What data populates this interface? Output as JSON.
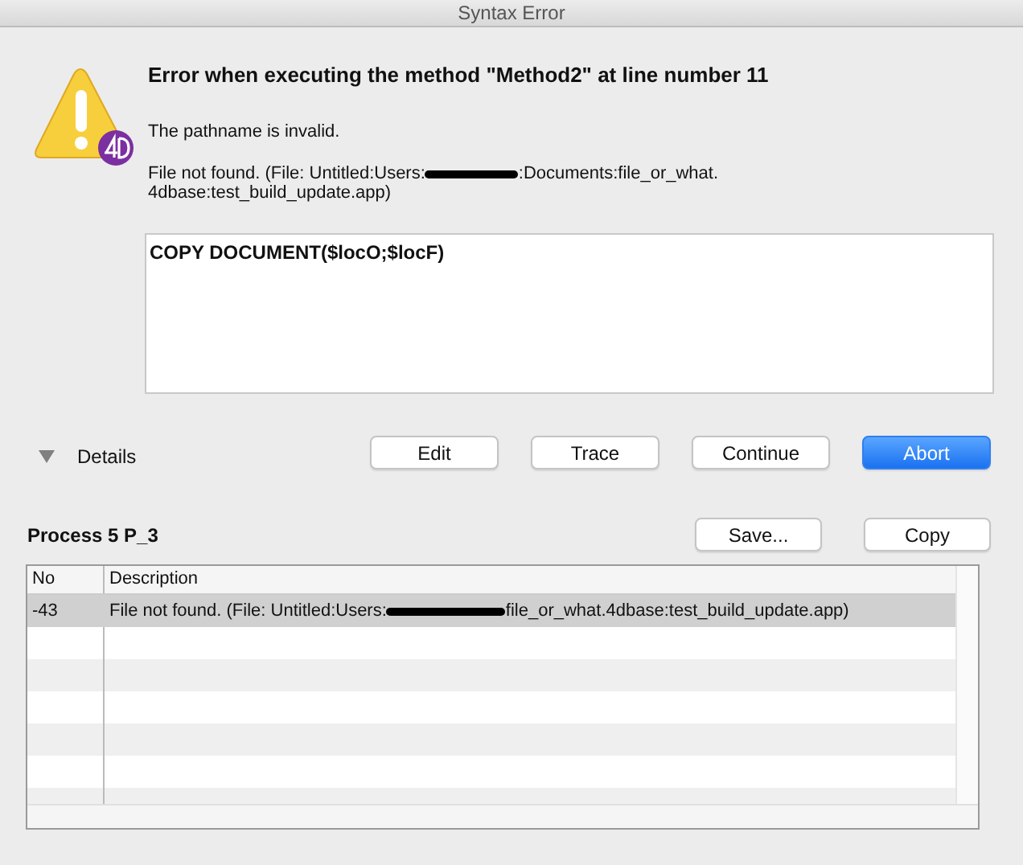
{
  "window": {
    "title": "Syntax Error"
  },
  "error": {
    "heading": "Error when executing the method \"Method2\" at line number 11",
    "reason": "The pathname is invalid.",
    "detail_before": "File not found. (File: Untitled:Users:",
    "detail_after": ":Documents:file_or_what.",
    "detail_line2": "4dbase:test_build_update.app)",
    "redacted": true
  },
  "code": "COPY DOCUMENT($locO;$locF)",
  "details": {
    "label": "Details",
    "expanded": true
  },
  "buttons": [
    {
      "label": "Edit",
      "default": false
    },
    {
      "label": "Trace",
      "default": false
    },
    {
      "label": "Continue",
      "default": false
    },
    {
      "label": "Abort",
      "default": true
    }
  ],
  "process": {
    "title": "Process 5 P_3",
    "buttons": [
      "Save...",
      "Copy"
    ]
  },
  "table": {
    "columns": [
      "No",
      "Description"
    ],
    "rows": [
      {
        "no": "-43",
        "before": "File not found. (File: Untitled:Users:",
        "after": "file_or_what.4dbase:test_build_update.app)",
        "redacted": true,
        "selected": true
      }
    ]
  }
}
